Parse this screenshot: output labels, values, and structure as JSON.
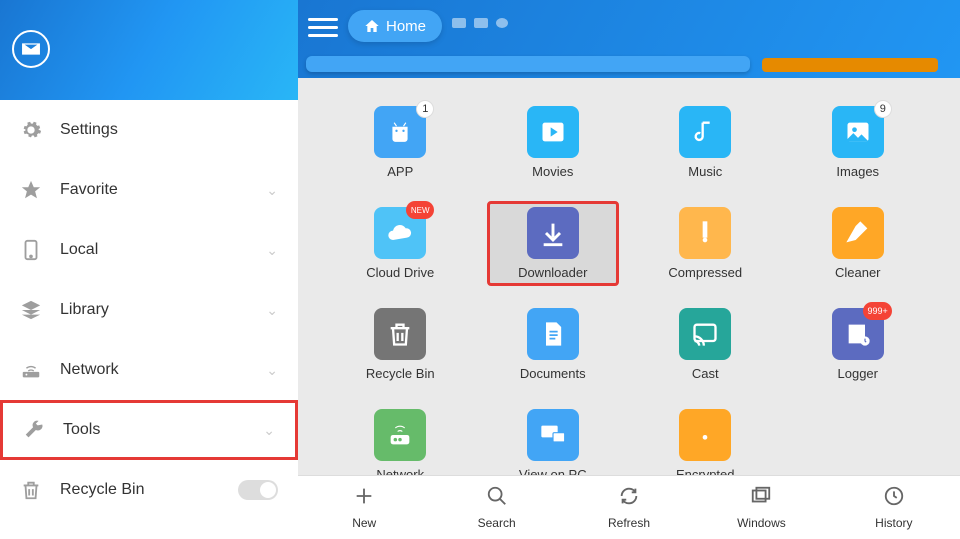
{
  "sidebar": {
    "items": [
      {
        "label": "Settings",
        "icon": "gear"
      },
      {
        "label": "Favorite",
        "icon": "star",
        "chevron": true
      },
      {
        "label": "Local",
        "icon": "phone",
        "chevron": true
      },
      {
        "label": "Library",
        "icon": "layers",
        "chevron": true
      },
      {
        "label": "Network",
        "icon": "network",
        "chevron": true
      },
      {
        "label": "Tools",
        "icon": "wrench",
        "chevron": true,
        "highlighted": true
      },
      {
        "label": "Recycle Bin",
        "icon": "trash",
        "toggle": true
      }
    ]
  },
  "header": {
    "home_label": "Home"
  },
  "grid": {
    "items": [
      {
        "label": "APP",
        "color": "#42a5f5",
        "icon": "android",
        "badge": "1"
      },
      {
        "label": "Movies",
        "color": "#29b6f6",
        "icon": "play"
      },
      {
        "label": "Music",
        "color": "#29b6f6",
        "icon": "music"
      },
      {
        "label": "Images",
        "color": "#29b6f6",
        "icon": "image",
        "badge": "9"
      },
      {
        "label": "Cloud Drive",
        "color": "#4fc3f7",
        "icon": "cloud",
        "badge_new": "NEW"
      },
      {
        "label": "Downloader",
        "color": "#5c6bc0",
        "icon": "download",
        "selected": true,
        "highlighted": true
      },
      {
        "label": "Compressed",
        "color": "#ffb74d",
        "icon": "zip"
      },
      {
        "label": "Cleaner",
        "color": "#ffa726",
        "icon": "broom"
      },
      {
        "label": "Recycle Bin",
        "color": "#757575",
        "icon": "trash"
      },
      {
        "label": "Documents",
        "color": "#42a5f5",
        "icon": "doc"
      },
      {
        "label": "Cast",
        "color": "#26a69a",
        "icon": "cast"
      },
      {
        "label": "Logger",
        "color": "#5c6bc0",
        "icon": "log",
        "badge_red": "999+"
      },
      {
        "label": "Network",
        "color": "#66bb6a",
        "icon": "router"
      },
      {
        "label": "View on PC",
        "color": "#42a5f5",
        "icon": "pc"
      },
      {
        "label": "Encrypted",
        "color": "#ffa726",
        "icon": "lock"
      }
    ]
  },
  "bottombar": {
    "items": [
      {
        "label": "New",
        "icon": "plus"
      },
      {
        "label": "Search",
        "icon": "search"
      },
      {
        "label": "Refresh",
        "icon": "refresh"
      },
      {
        "label": "Windows",
        "icon": "windows"
      },
      {
        "label": "History",
        "icon": "clock"
      }
    ]
  }
}
